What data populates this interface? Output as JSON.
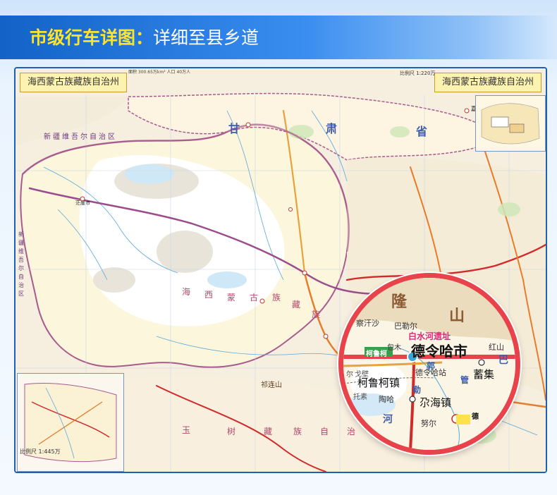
{
  "banner": {
    "title_highlight": "市级行车详图：",
    "title_rest": "详细至县乡道"
  },
  "map": {
    "header_left": "海西蒙古族藏族自治州",
    "header_right": "海西蒙古族藏族自治州",
    "scale_top": "比例尺 1:220万",
    "scale_bottom": "比例尺 1:445万",
    "legend_text": "面积  300.65万km²  人口  40万人",
    "region_labels": {
      "xinjiang": "新疆维吾尔自治区",
      "xinjiang_vertical": "新疆维吾尔自治区",
      "gansu_a": "甘",
      "gansu_b": "肃",
      "gansu_c": "省",
      "haixi_1": "海",
      "haixi_2": "西",
      "haixi_3": "蒙",
      "haixi_4": "古",
      "haixi_5": "族",
      "haixi_6": "藏",
      "haixi_7": "族",
      "yushu_1": "玉",
      "yushu_2": "树",
      "yushu_3": "藏",
      "yushu_4": "族",
      "yushu_5": "自",
      "yushu_6": "治",
      "yushu_7": "州",
      "qilian": "祁连山",
      "top_city": "嘉峪关",
      "mangya": "茫崖市"
    },
    "zoom": {
      "mountain_1": "隆",
      "mountain_2": "山",
      "place_1": "察汗沙",
      "place_2": "巴勒尔",
      "place_3": "白水河遗址",
      "place_4": "包木",
      "city_main": "德令哈市",
      "place_5": "红山",
      "place_6": "柯鲁柯",
      "place_7": "郭",
      "place_8": "巴",
      "place_9": "尔",
      "place_10": "戈壁",
      "station": "德令哈站",
      "town_1": "柯鲁柯镇",
      "town_2": "蓄集",
      "lake": "托素",
      "place_11": "陶哈",
      "town_3": "尕海镇",
      "place_12": "勒",
      "place_13": "河",
      "place_14": "德",
      "place_15": "努尔",
      "place_16": "管"
    }
  }
}
